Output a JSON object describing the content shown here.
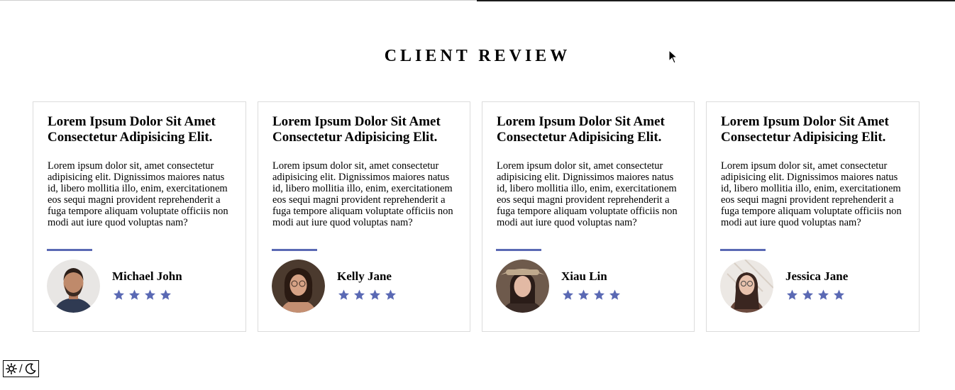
{
  "section": {
    "title": "CLIENT REVIEW"
  },
  "theme_toggle": {
    "separator": "/"
  },
  "colors": {
    "accent": "#5a69b4",
    "card_border": "#dcdcdc"
  },
  "reviews": [
    {
      "heading": "Lorem Ipsum Dolor Sit Amet Consectetur Adipisicing Elit.",
      "text": "Lorem ipsum dolor sit, amet consectetur adipisicing elit. Dignissimos maiores natus id, libero mollitia illo, enim, exercitationem eos sequi magni provident reprehenderit a fuga tempore aliquam voluptate officiis non modi aut iure quod voluptas nam?",
      "name": "Michael John",
      "rating": 4
    },
    {
      "heading": "Lorem Ipsum Dolor Sit Amet Consectetur Adipisicing Elit.",
      "text": "Lorem ipsum dolor sit, amet consectetur adipisicing elit. Dignissimos maiores natus id, libero mollitia illo, enim, exercitationem eos sequi magni provident reprehenderit a fuga tempore aliquam voluptate officiis non modi aut iure quod voluptas nam?",
      "name": "Kelly Jane",
      "rating": 4
    },
    {
      "heading": "Lorem Ipsum Dolor Sit Amet Consectetur Adipisicing Elit.",
      "text": "Lorem ipsum dolor sit, amet consectetur adipisicing elit. Dignissimos maiores natus id, libero mollitia illo, enim, exercitationem eos sequi magni provident reprehenderit a fuga tempore aliquam voluptate officiis non modi aut iure quod voluptas nam?",
      "name": "Xiau Lin",
      "rating": 4
    },
    {
      "heading": "Lorem Ipsum Dolor Sit Amet Consectetur Adipisicing Elit.",
      "text": "Lorem ipsum dolor sit, amet consectetur adipisicing elit. Dignissimos maiores natus id, libero mollitia illo, enim, exercitationem eos sequi magni provident reprehenderit a fuga tempore aliquam voluptate officiis non modi aut iure quod voluptas nam?",
      "name": "Jessica Jane",
      "rating": 4
    }
  ]
}
